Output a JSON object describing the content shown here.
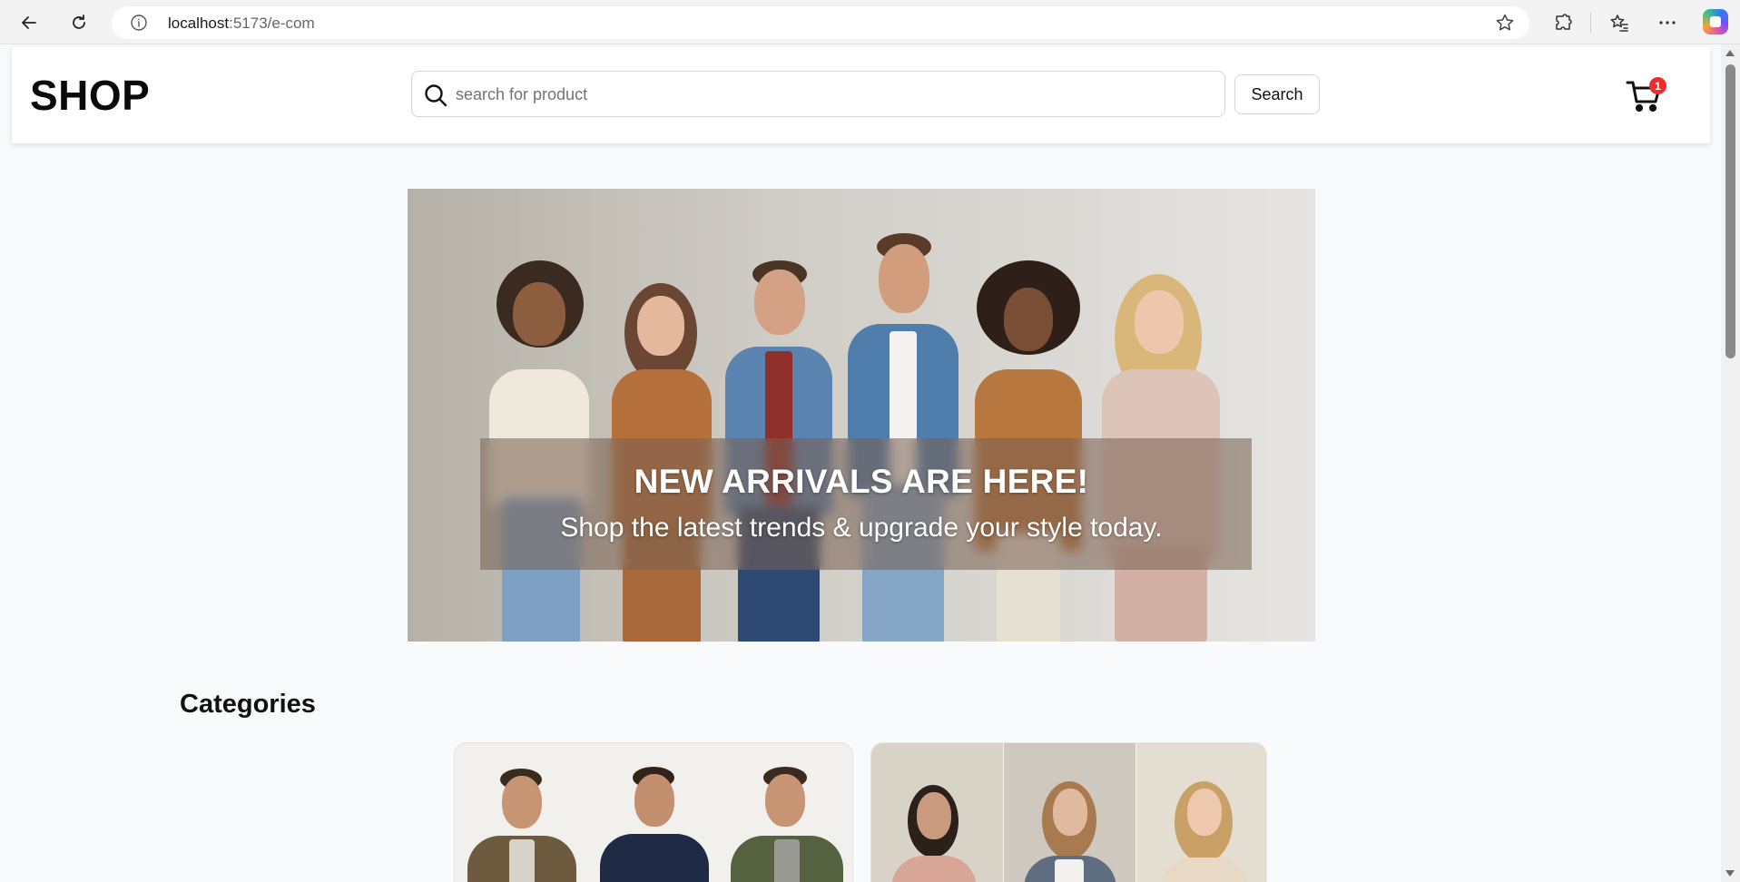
{
  "browser": {
    "url_host": "localhost",
    "url_path": ":5173/e-com",
    "icons": [
      "back-icon",
      "reload-icon",
      "info-icon",
      "star-icon",
      "extensions-icon",
      "favorites-icon",
      "more-icon",
      "copilot-icon"
    ]
  },
  "header": {
    "logo": "SHOP",
    "search": {
      "placeholder": "search for product",
      "value": ""
    },
    "search_button": "Search",
    "cart_count": "1"
  },
  "hero": {
    "title": "NEW ARRIVALS ARE HERE!",
    "subtitle": "Shop the latest trends & upgrade your style today."
  },
  "categories": {
    "title": "Categories"
  },
  "colors": {
    "badge": "#ef2b2b",
    "page_bg": "#f8fafc"
  }
}
